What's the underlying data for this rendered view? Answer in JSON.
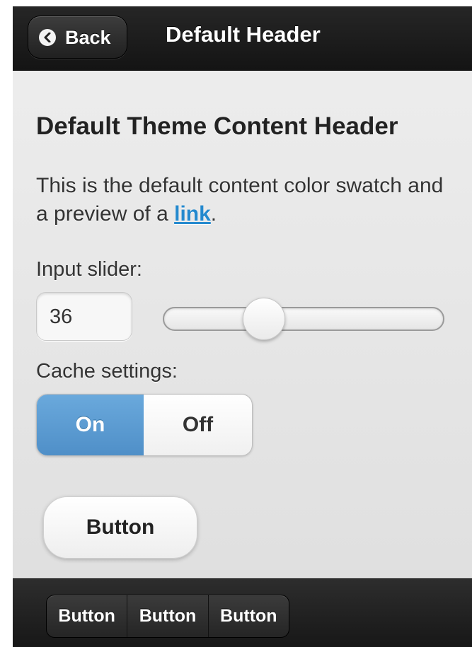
{
  "header": {
    "back_label": "Back",
    "title": "Default Header"
  },
  "content": {
    "title": "Default Theme Content Header",
    "paragraph_before_link": "This is the default content color swatch and a preview of a ",
    "link_text": "link",
    "paragraph_after_link": "."
  },
  "slider": {
    "label": "Input slider:",
    "value": "36"
  },
  "cache": {
    "label": "Cache settings:",
    "options": [
      "On",
      "Off"
    ],
    "selected": "On"
  },
  "button": {
    "label": "Button"
  },
  "footer": {
    "buttons": [
      "Button",
      "Button",
      "Button"
    ]
  },
  "colors": {
    "accent": "#4f8fc8",
    "link": "#2489ce",
    "header_bg": "#1a1a1a",
    "content_bg": "#e7e7e7"
  },
  "icons": {
    "back": "chevron-left-icon"
  }
}
